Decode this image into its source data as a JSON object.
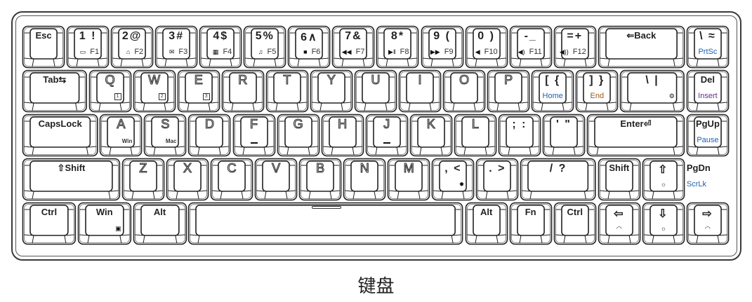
{
  "caption": "键盘",
  "colors": {
    "outline": "#222222",
    "blue": "#1f5fb0",
    "brown": "#9a5a10",
    "purple": "#6a2a8a"
  },
  "keyboard": {
    "rows": [
      {
        "keys": [
          {
            "main": "Esc"
          },
          {
            "main": "1 !",
            "sub": "F1",
            "icon": "computer"
          },
          {
            "main": "2@",
            "sub": "F2",
            "icon": "home"
          },
          {
            "main": "3#",
            "sub": "F3",
            "icon": "mail"
          },
          {
            "main": "4$",
            "sub": "F4",
            "icon": "calculator"
          },
          {
            "main": "5%",
            "sub": "F5",
            "icon": "music"
          },
          {
            "main": "6∧",
            "sub": "F6",
            "icon": "stop"
          },
          {
            "main": "7&",
            "sub": "F7",
            "icon": "previous"
          },
          {
            "main": "8*",
            "sub": "F8",
            "icon": "play-pause"
          },
          {
            "main": "9 (",
            "sub": "F9",
            "icon": "next"
          },
          {
            "main": "0 )",
            "sub": "F10",
            "icon": "mute"
          },
          {
            "main": "-_",
            "sub": "F11",
            "icon": "volume-down"
          },
          {
            "main": "=+",
            "sub": "F12",
            "icon": "volume-up"
          },
          {
            "main": "⇐Back"
          },
          {
            "main": "\\ ≈",
            "sub": "PrtSc",
            "sub_color": "#1f5fb0"
          }
        ]
      },
      {
        "keys": [
          {
            "main": "Tab⇆"
          },
          {
            "main": "Q",
            "sub": "1",
            "boxed": true
          },
          {
            "main": "W",
            "sub": "2",
            "boxed": true
          },
          {
            "main": "E",
            "sub": "3",
            "boxed": true
          },
          {
            "main": "R"
          },
          {
            "main": "T"
          },
          {
            "main": "Y"
          },
          {
            "main": "U"
          },
          {
            "main": "I"
          },
          {
            "main": "O"
          },
          {
            "main": "P"
          },
          {
            "main": "[ {",
            "sub": "Home",
            "sub_color": "#1f5fb0"
          },
          {
            "main": "] }",
            "sub": "End",
            "sub_color": "#9a5a10"
          },
          {
            "main": "\\ |",
            "icon": "gear"
          },
          {
            "main": "Del",
            "sub": "Insert",
            "sub_color": "#6a2a8a"
          }
        ]
      },
      {
        "keys": [
          {
            "main": "CapsLock"
          },
          {
            "main": "A",
            "sub": "Win"
          },
          {
            "main": "S",
            "sub": "Mac"
          },
          {
            "main": "D"
          },
          {
            "main": "F"
          },
          {
            "main": "G"
          },
          {
            "main": "H"
          },
          {
            "main": "J"
          },
          {
            "main": "K"
          },
          {
            "main": "L"
          },
          {
            "main": "; :"
          },
          {
            "main": "' \""
          },
          {
            "main": "Enter⏎"
          },
          {
            "main": "PgUp",
            "sub": "Pause",
            "sub_color": "#1f5fb0"
          }
        ]
      },
      {
        "keys": [
          {
            "main": "⇧Shift"
          },
          {
            "main": "Z"
          },
          {
            "main": "X"
          },
          {
            "main": "C"
          },
          {
            "main": "V"
          },
          {
            "main": "B"
          },
          {
            "main": "N"
          },
          {
            "main": "M"
          },
          {
            "main": ", <",
            "icon": "brightness-dark"
          },
          {
            "main": ". >"
          },
          {
            "main": "/ ?"
          },
          {
            "main": "Shift"
          },
          {
            "main": "⇧",
            "icon": "brightness-up"
          },
          {
            "main": "PgDn",
            "sub": "ScrLk",
            "sub_color": "#1f5fb0"
          }
        ]
      },
      {
        "keys": [
          {
            "main": "Ctrl"
          },
          {
            "main": "Win",
            "icon": "lock"
          },
          {
            "main": "Alt"
          },
          {
            "main": ""
          },
          {
            "main": "Alt"
          },
          {
            "main": "Fn"
          },
          {
            "main": "Ctrl"
          },
          {
            "main": "⇦",
            "icon": "speed-down"
          },
          {
            "main": "⇩",
            "icon": "brightness-down"
          },
          {
            "main": "⇨",
            "icon": "speed-up"
          }
        ]
      }
    ]
  }
}
